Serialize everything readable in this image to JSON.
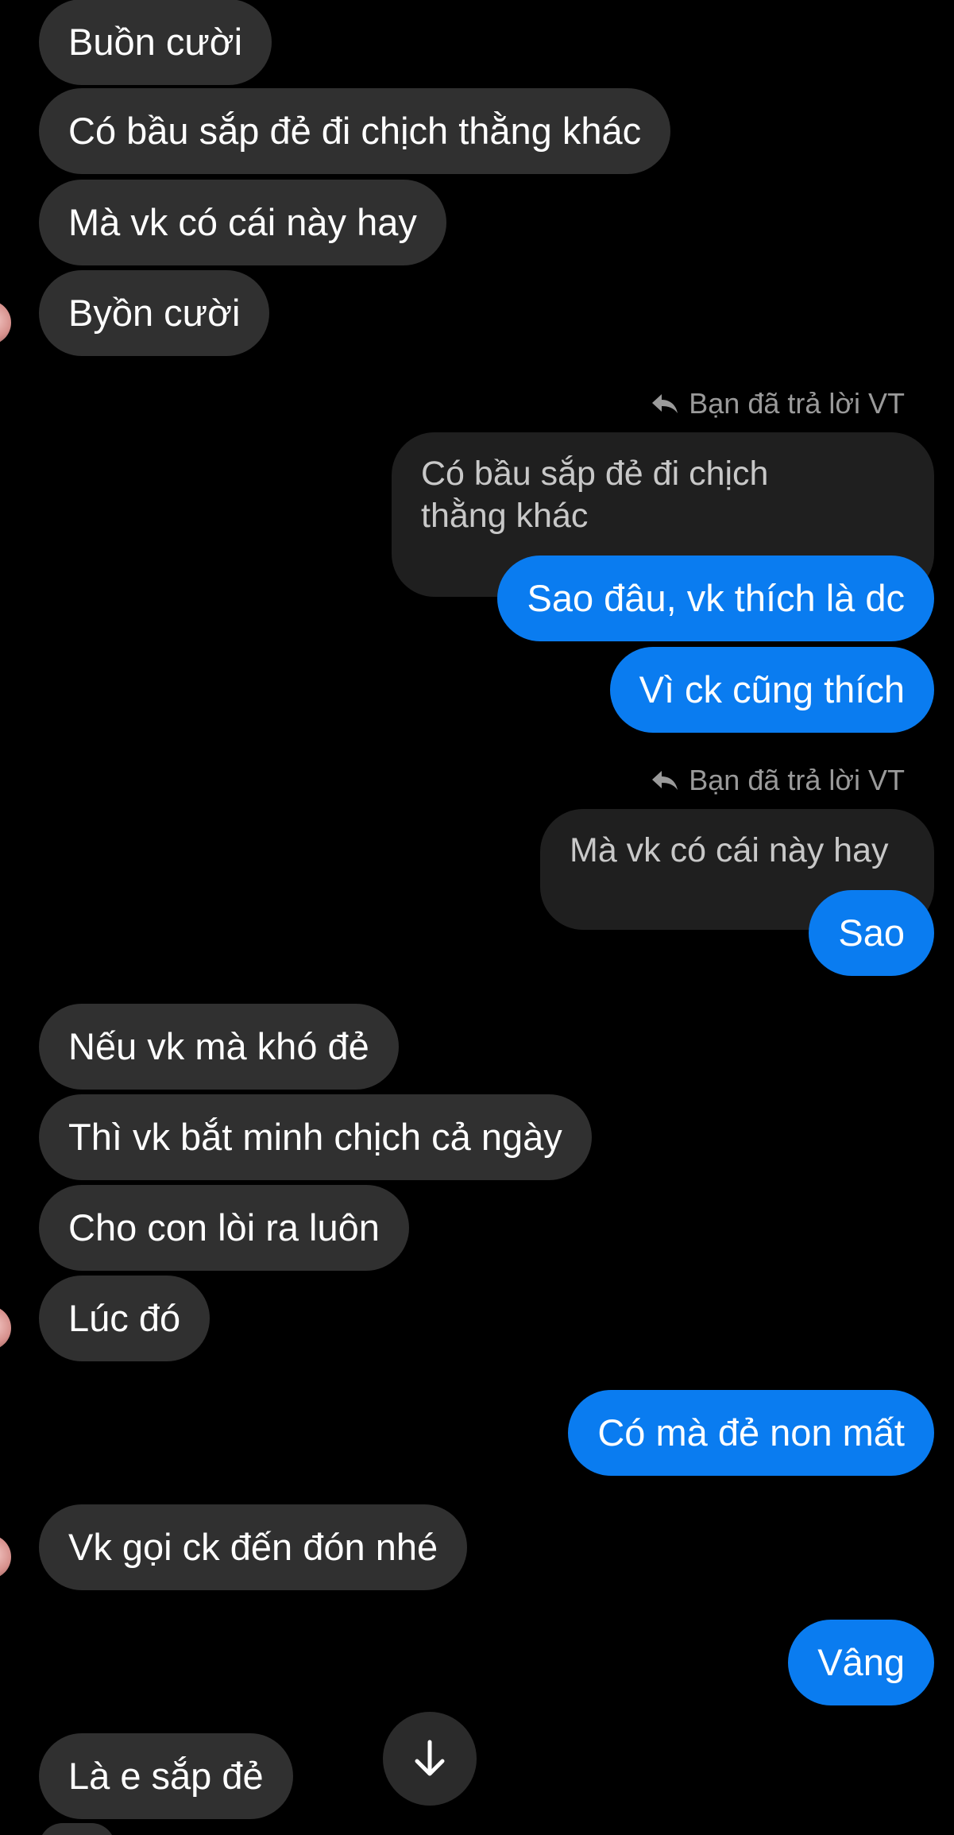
{
  "colors": {
    "background": "#000000",
    "incoming_bubble": "#303030",
    "outgoing_bubble": "#0a7cf0",
    "quoted_bubble": "#1f1f1f",
    "meta_text": "#9a9a9a"
  },
  "thread": {
    "incoming_1": [
      "Buồn cười",
      "Có bầu sắp đẻ đi chịch thằng khác",
      "Mà vk có cái này hay",
      "Byồn cười"
    ],
    "reply_1": {
      "label": "Bạn đã trả lời VT",
      "icon": "reply-arrow-icon",
      "quoted": "Có bầu sắp đẻ đi chịch\nthằng khác"
    },
    "outgoing_1": [
      "Sao đâu, vk thích là dc",
      "Vì ck cũng thích"
    ],
    "reply_2": {
      "label": "Bạn đã trả lời VT",
      "icon": "reply-arrow-icon",
      "quoted": "Mà vk có cái này hay"
    },
    "outgoing_2": [
      "Sao"
    ],
    "incoming_2": [
      "Nếu vk mà khó đẻ",
      "Thì vk bắt minh chịch cả ngày",
      "Cho con lòi ra luôn",
      "Lúc đó"
    ],
    "outgoing_3": [
      "Có mà đẻ non mất"
    ],
    "incoming_3": [
      "Vk gọi ck đến đón nhé"
    ],
    "outgoing_4": [
      "Vâng"
    ],
    "incoming_4": [
      "Là e sắp đẻ"
    ]
  },
  "controls": {
    "scroll_down_icon": "arrow-down-icon"
  }
}
